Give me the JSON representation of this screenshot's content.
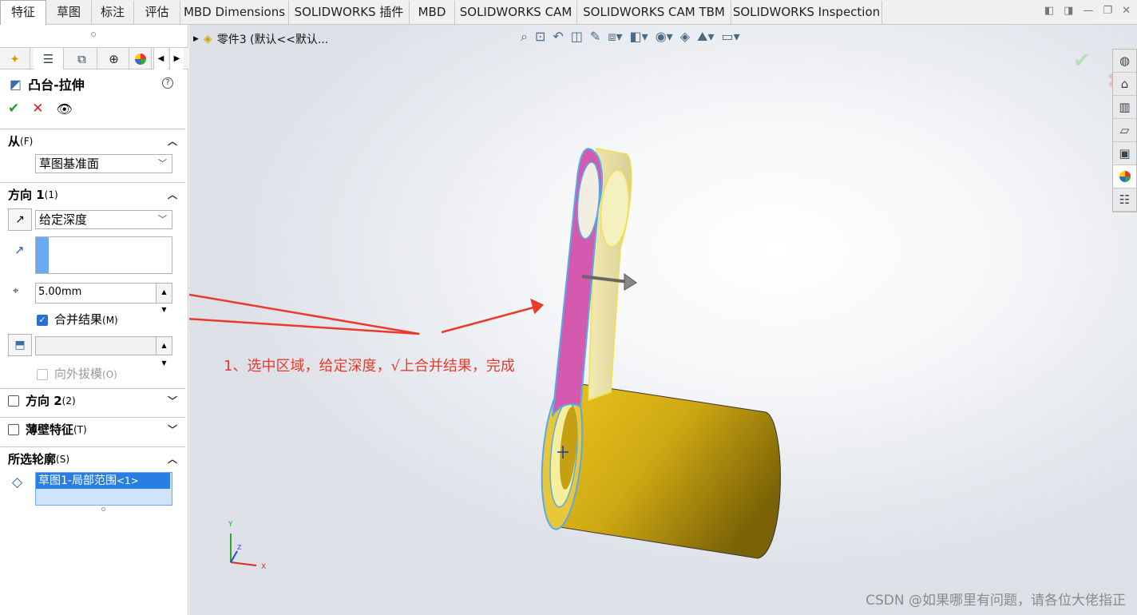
{
  "tabs": [
    {
      "label": "特征",
      "active": true
    },
    {
      "label": "草图",
      "active": false
    },
    {
      "label": "标注",
      "active": false
    },
    {
      "label": "评估",
      "active": false
    },
    {
      "label": "MBD Dimensions",
      "active": false
    },
    {
      "label": "SOLIDWORKS 插件",
      "active": false
    },
    {
      "label": "MBD",
      "active": false
    },
    {
      "label": "SOLIDWORKS CAM",
      "active": false
    },
    {
      "label": "SOLIDWORKS CAM TBM",
      "active": false
    },
    {
      "label": "SOLIDWORKS Inspection",
      "active": false
    }
  ],
  "feature": {
    "title": "凸台-拉伸",
    "help": "?"
  },
  "from_section": {
    "heading": "从",
    "hotkey": "(F)",
    "value": "草图基准面"
  },
  "direction1": {
    "heading": "方向 1",
    "hotkey": "(1)",
    "end_condition": "给定深度",
    "depth": "5.00mm",
    "merge_label": "合并结果",
    "merge_hotkey": "(M)",
    "merge_checked": true,
    "draft_label": "向外拔模",
    "draft_hotkey": "(O)"
  },
  "direction2": {
    "heading": "方向 2",
    "hotkey": "(2)"
  },
  "thin_feature": {
    "heading": "薄壁特征",
    "hotkey": "(T)"
  },
  "selected_contours": {
    "heading": "所选轮廓",
    "hotkey": "(S)",
    "item_main": "草图1-局部范围",
    "item_suffix": "<1>"
  },
  "viewport": {
    "breadcrumb": "零件3  (默认<<默认...",
    "annotation": "1、选中区域，给定深度，√上合并结果，完成",
    "watermark": "CSDN @如果哪里有问题，请各位大佬指正",
    "axis_labels": {
      "x": "X",
      "y": "Y",
      "z": "Z"
    }
  },
  "icons": {
    "headsup": [
      "zoom-to-fit-icon",
      "zoom-area-icon",
      "previous-view-icon",
      "section-view-icon",
      "dynamic-annotation-icon",
      "view-orientation-icon",
      "display-style-icon",
      "hide-show-icon",
      "edit-appearance-icon",
      "apply-scene-icon",
      "view-settings-icon"
    ],
    "right_panel": [
      "solidworks-resources-icon",
      "design-library-icon",
      "file-explorer-icon",
      "view-palette-icon",
      "appearances-icon",
      "custom-properties-icon"
    ]
  },
  "colors": {
    "accent": "#2a6fd6",
    "annotation": "#e83a2e",
    "part_yellow": "#d9b614",
    "selected_face": "#d45ab0",
    "edge_highlight": "#5aa9e6"
  }
}
